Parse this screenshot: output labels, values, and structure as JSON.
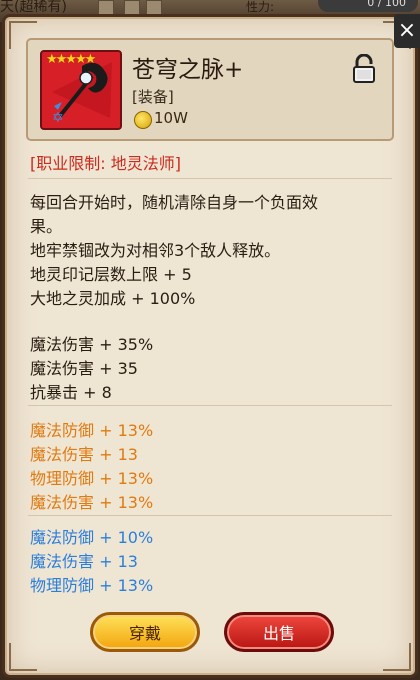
{
  "background": {
    "left_text": "天(超稀有)",
    "right_text": "性力:",
    "pill_text": "0 / 100"
  },
  "item": {
    "stars": "★★★★★",
    "title": "苍穹之脉+",
    "type": "[装备]",
    "price": "10W",
    "restriction": "[职业限制: 地灵法师]"
  },
  "description_lines": [
    "每回合开始时，随机清除自身一个负面效",
    "果。",
    "地牢禁锢改为对相邻3个敌人释放。",
    "地灵印记层数上限 + 5",
    "大地之灵加成 + 100%"
  ],
  "base_stats": [
    "魔法伤害 + 35%",
    "魔法伤害 + 35",
    "抗暴击 + 8"
  ],
  "orange_stats": [
    "魔法防御 + 13%",
    "魔法伤害 + 13",
    "物理防御 + 13%",
    "魔法伤害 + 13%"
  ],
  "blue_stats": [
    "魔法防御 + 10%",
    "魔法伤害 + 13",
    "物理防御 + 13%"
  ],
  "buttons": {
    "equip_label": "穿戴",
    "sell_label": "出售"
  },
  "close_label": "×",
  "colors": {
    "restriction": "#cc2a1e",
    "orange_stat": "#e07b12",
    "blue_stat": "#2b7fdc"
  }
}
